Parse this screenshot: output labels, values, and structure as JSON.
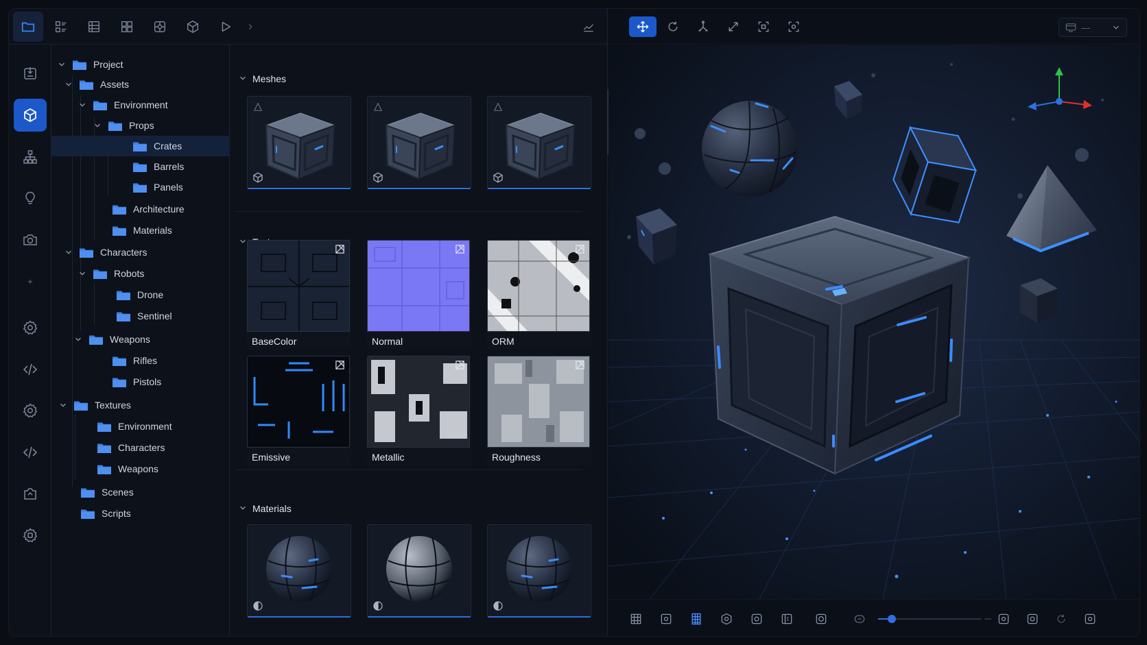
{
  "tree": {
    "items": [
      {
        "label": "Project"
      },
      {
        "label": "Assets"
      },
      {
        "label": "Environment"
      },
      {
        "label": "Props"
      },
      {
        "label": "Crates"
      },
      {
        "label": "Barrels"
      },
      {
        "label": "Panels"
      },
      {
        "label": "Architecture"
      },
      {
        "label": "Materials"
      },
      {
        "label": "Characters"
      },
      {
        "label": "Robots"
      },
      {
        "label": "Drone"
      },
      {
        "label": "Sentinel"
      },
      {
        "label": "Weapons"
      },
      {
        "label": "Rifles"
      },
      {
        "label": "Pistols"
      },
      {
        "label": "Textures"
      },
      {
        "label": "Environment"
      },
      {
        "label": "Characters"
      },
      {
        "label": "Weapons"
      },
      {
        "label": "Scenes"
      },
      {
        "label": "Scripts"
      }
    ]
  },
  "assets": {
    "meshes_title": "Meshes",
    "textures_title": "Textures",
    "materials_title": "Materials",
    "textures": [
      {
        "label": "BaseColor"
      },
      {
        "label": "Normal"
      },
      {
        "label": "ORM"
      },
      {
        "label": "Emissive"
      },
      {
        "label": "Metallic"
      },
      {
        "label": "Roughness"
      }
    ]
  },
  "viewport": {
    "dropdown_value": "—",
    "zoom_level": 0.13
  },
  "colors": {
    "accent": "#1c58c9",
    "folder": "#3d7fe0",
    "glow": "#3b8cff"
  }
}
